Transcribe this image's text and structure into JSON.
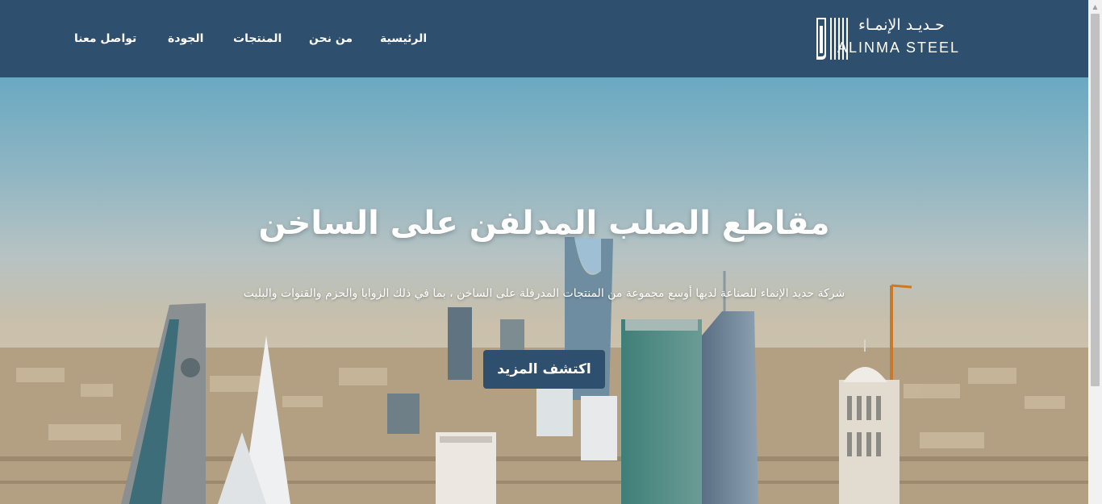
{
  "header": {
    "nav": [
      {
        "label": "الرئيسية"
      },
      {
        "label": "من نحن"
      },
      {
        "label": "المنتجات"
      },
      {
        "label": "الجودة"
      },
      {
        "label": "تواصل معنا"
      }
    ],
    "logo": {
      "arabic": "حـديـد الإنمـاء",
      "english": "ALINMA STEEL"
    }
  },
  "hero": {
    "title": "مقاطع الصلب المدلفن على الساخن",
    "subtitle": "شركة حديد الإنماء للصناعة لديها أوسع مجموعة من المنتجات المدرفلة على الساخن ، بما في ذلك الزوايا والحزم والقنوات والبليت",
    "button_label": "اكتشف المزيد"
  },
  "colors": {
    "header_bg": "#2f4f6e",
    "button_bg": "#2f4f6e",
    "text_on_dark": "#ffffff"
  }
}
